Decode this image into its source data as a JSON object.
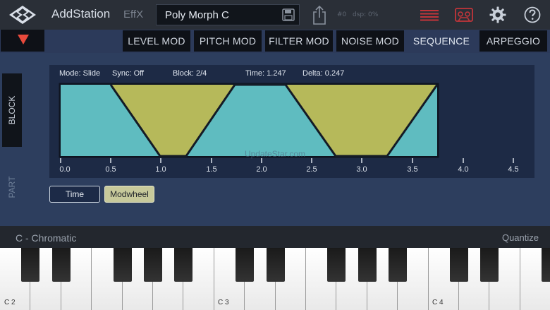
{
  "header": {
    "app_name": "AddStation",
    "effx_label": "EffX",
    "preset_name": "Poly Morph C",
    "stat_voices": "#0",
    "stat_dsp": "dsp: 0%",
    "icons": {
      "logo": "diamond-grid-logo",
      "save": "floppy-disk-icon",
      "share": "share-icon",
      "menu": "red-lines-menu-icon",
      "tape": "cassette-tape-icon",
      "settings": "gear-icon",
      "help": "question-mark-icon"
    }
  },
  "tabs": [
    {
      "label": "LEVEL MOD",
      "active": false
    },
    {
      "label": "PITCH MOD",
      "active": false
    },
    {
      "label": "FILTER MOD",
      "active": false
    },
    {
      "label": "NOISE MOD",
      "active": false
    },
    {
      "label": "SEQUENCE",
      "active": true
    },
    {
      "label": "ARPEGGIO",
      "active": false
    }
  ],
  "side": {
    "block_label": "BLOCK",
    "part_label": "PART"
  },
  "graph": {
    "mode": "Mode: Slide",
    "sync": "Sync: Off",
    "block": "Block: 2/4",
    "time": "Time: 1.247",
    "delta": "Delta: 0.247",
    "watermark": "UpdateStar.com",
    "ticks": [
      "0.0",
      "0.5",
      "1.0",
      "1.5",
      "2.0",
      "2.5",
      "3.0",
      "3.5",
      "4.0",
      "4.5"
    ],
    "colors": {
      "cyan": "#5fbcc0",
      "yellow": "#b6b95a",
      "background": "#1d2a45"
    }
  },
  "buttons": {
    "time": "Time",
    "modwheel": "Modwheel"
  },
  "keyboard": {
    "scale": "C - Chromatic",
    "quantize": "Quantize",
    "octave_labels": [
      "C 2",
      "C 3",
      "C 4"
    ]
  }
}
